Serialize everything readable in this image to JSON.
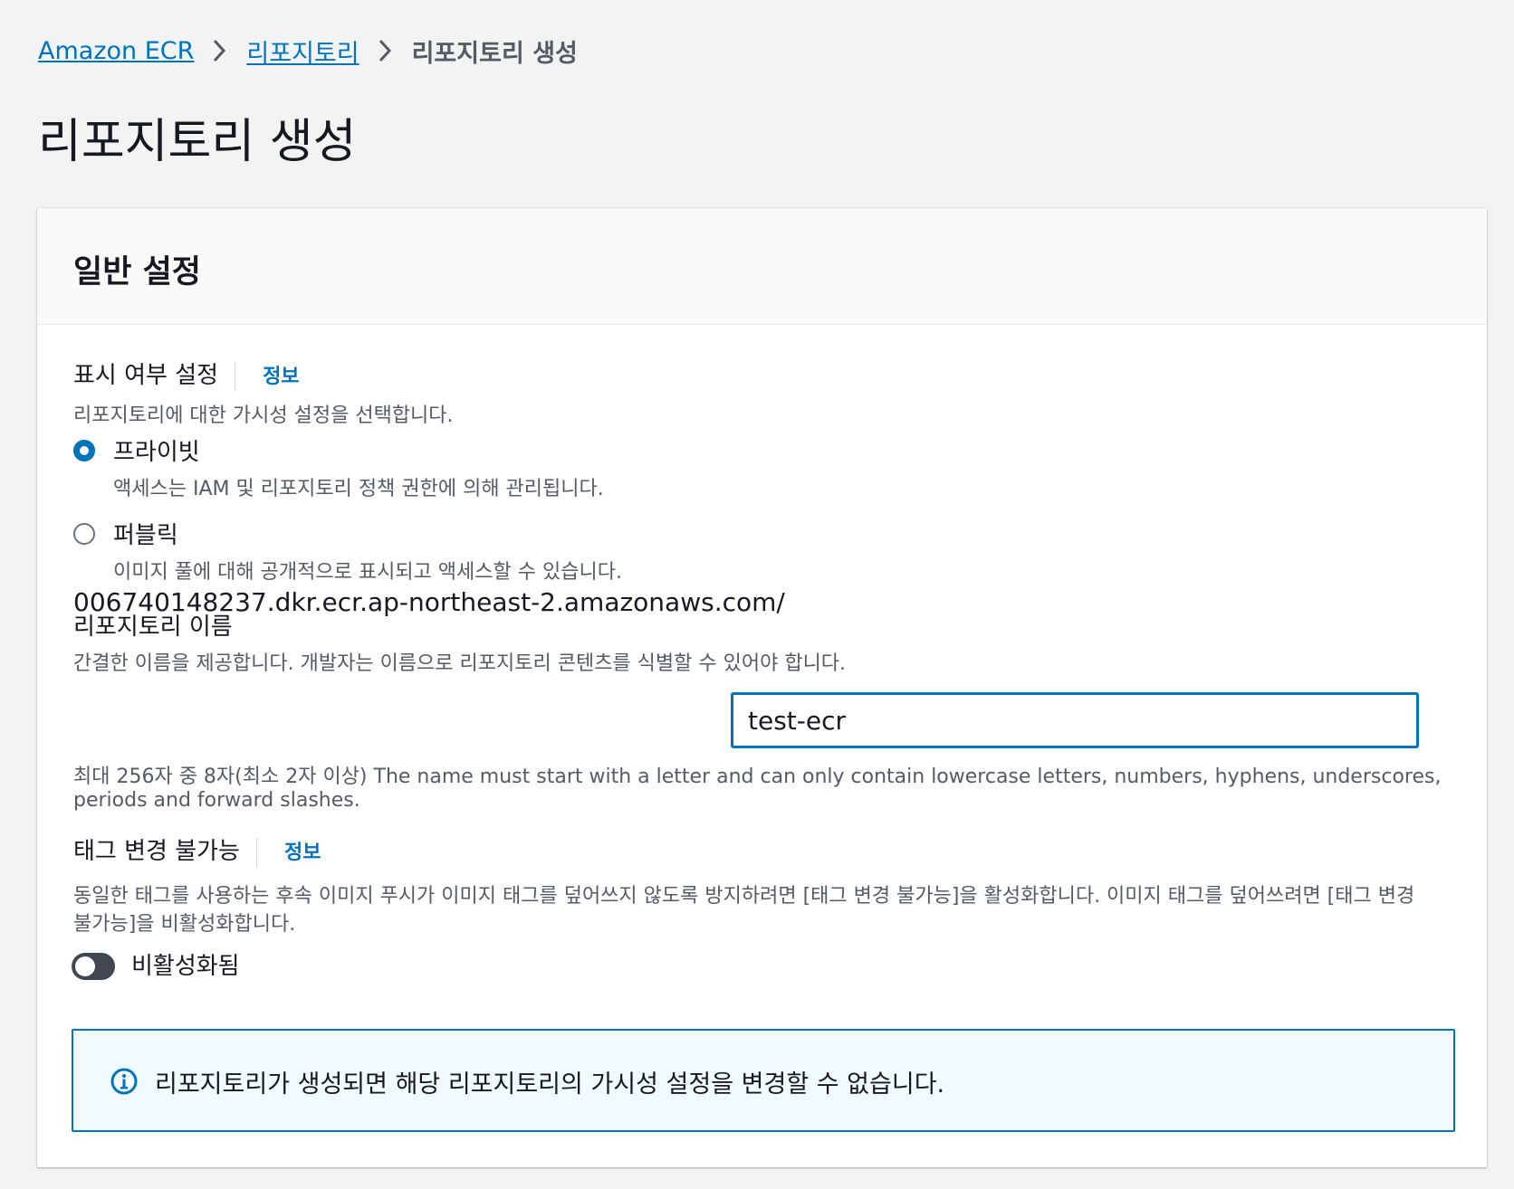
{
  "breadcrumb": {
    "items": [
      "Amazon ECR",
      "리포지토리"
    ],
    "current": "리포지토리 생성"
  },
  "page_title": "리포지토리 생성",
  "panel": {
    "title": "일반 설정"
  },
  "visibility": {
    "label": "표시 여부 설정",
    "info": "정보",
    "description": "리포지토리에 대한 가시성 설정을 선택합니다.",
    "options": [
      {
        "label": "프라이빗",
        "description": "액세스는 IAM 및 리포지토리 정책 권한에 의해 관리됩니다.",
        "selected": true
      },
      {
        "label": "퍼블릭",
        "description": "이미지 풀에 대해 공개적으로 표시되고 액세스할 수 있습니다.",
        "selected": false
      }
    ]
  },
  "repo_name": {
    "label": "리포지토리 이름",
    "description": "간결한 이름을 제공합니다. 개발자는 이름으로 리포지토리 콘텐츠를 식별할 수 있어야 합니다.",
    "prefix": "006740148237.dkr.ecr.ap-northeast-2.amazonaws.com/",
    "value": "test-ecr",
    "hint_line1": "최대 256자 중 8자(최소 2자 이상) The name must start with a letter and can only contain lowercase letters, numbers, hyphens, underscores,",
    "hint_line2": "periods and forward slashes."
  },
  "tag_immutability": {
    "label": "태그 변경 불가능",
    "info": "정보",
    "description_line1": "동일한 태그를 사용하는 후속 이미지 푸시가 이미지 태그를 덮어쓰지 않도록 방지하려면 [태그 변경 불가능]을 활성화합니다. 이미지 태그를 덮어쓰려면 [태그 변경",
    "description_line2": "불가능]을 비활성화합니다.",
    "toggle_label": "비활성화됨",
    "enabled": false
  },
  "alert": {
    "text": "리포지토리가 생성되면 해당 리포지토리의 가시성 설정을 변경할 수 없습니다."
  },
  "colors": {
    "link": "#0073bb",
    "background": "#f2f3f3",
    "toggle_off": "#414750"
  }
}
